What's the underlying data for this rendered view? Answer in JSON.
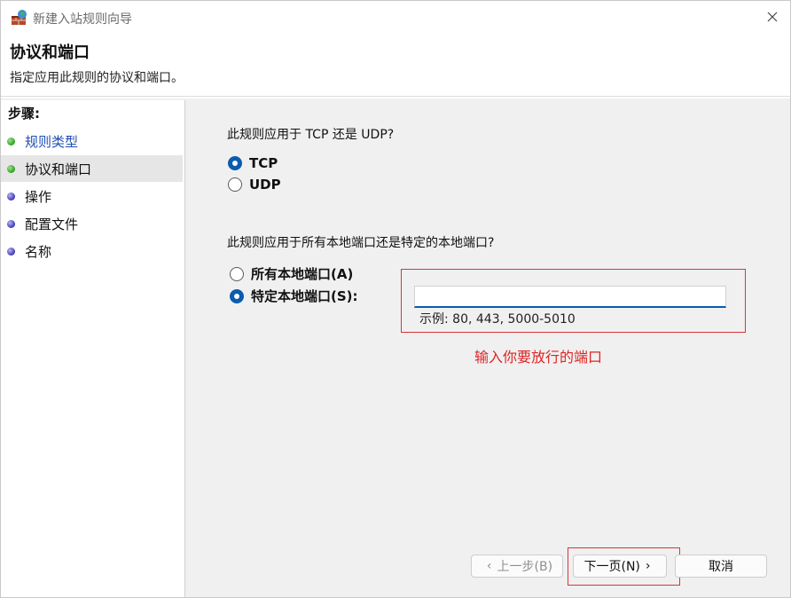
{
  "window": {
    "title": "新建入站规则向导",
    "close_label": "✕"
  },
  "header": {
    "title": "协议和端口",
    "subtitle": "指定应用此规则的协议和端口。"
  },
  "steps": {
    "heading": "步骤:",
    "items": [
      {
        "label": "规则类型",
        "status": "done"
      },
      {
        "label": "协议和端口",
        "status": "current"
      },
      {
        "label": "操作",
        "status": "pending"
      },
      {
        "label": "配置文件",
        "status": "pending"
      },
      {
        "label": "名称",
        "status": "pending"
      }
    ]
  },
  "protocol": {
    "question": "此规则应用于 TCP 还是 UDP?",
    "options": [
      {
        "label": "TCP",
        "checked": true
      },
      {
        "label": "UDP",
        "checked": false
      }
    ]
  },
  "ports": {
    "question": "此规则应用于所有本地端口还是特定的本地端口?",
    "options": [
      {
        "label": "所有本地端口(A)",
        "checked": false
      },
      {
        "label": "特定本地端口(S):",
        "checked": true
      }
    ],
    "input_value": "",
    "example": "示例: 80, 443, 5000-5010",
    "annotation": "输入你要放行的端口"
  },
  "buttons": {
    "back": "上一步(B)",
    "next": "下一页(N)",
    "cancel": "取消"
  },
  "colors": {
    "accent": "#0b5cad",
    "annotation_red": "#e02424",
    "step_done": "#2f9e24",
    "step_pending": "#3d38b8"
  }
}
